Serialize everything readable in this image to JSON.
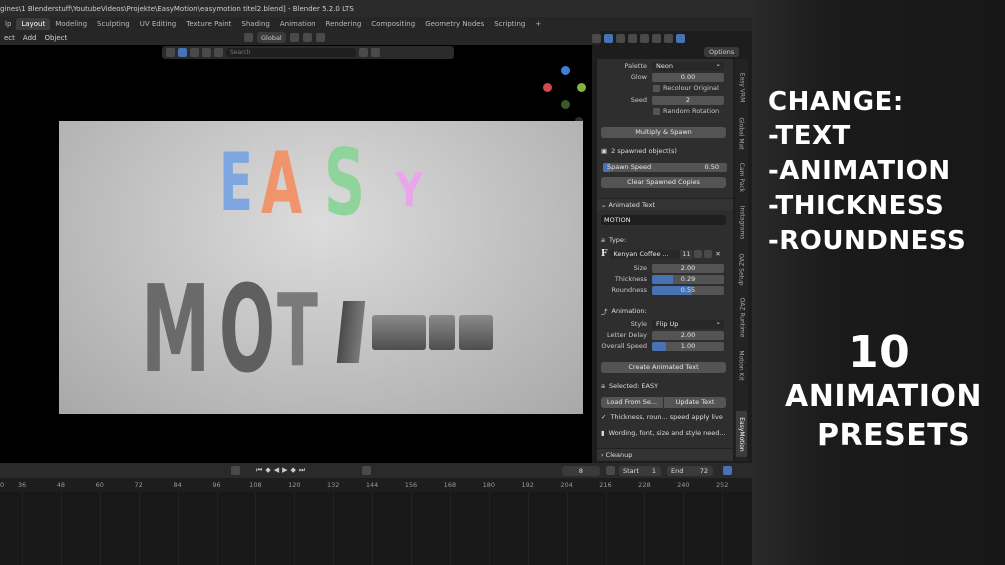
{
  "titlebar": {
    "title": "gines\\1 Blenderstuff\\YoutubeVideos\\Projekte\\EasyMotion\\easymotion titel2.blend] - Blender 5.2.0 LTS"
  },
  "workspace_tabs": [
    "lp",
    "Layout",
    "Modeling",
    "Sculpting",
    "UV Editing",
    "Texture Paint",
    "Shading",
    "Animation",
    "Rendering",
    "Compositing",
    "Geometry Nodes",
    "Scripting",
    "+"
  ],
  "menubar": [
    "ect",
    "Add",
    "Object"
  ],
  "header": {
    "transform_orientation": "Global",
    "options": "Options"
  },
  "viewport": {
    "search_placeholder": "Search"
  },
  "render_letters": [
    {
      "ch": "E",
      "color": "#7ea6e0"
    },
    {
      "ch": "A",
      "color": "#f0946c"
    },
    {
      "ch": "S",
      "color": "#8fd49a"
    },
    {
      "ch": "Y",
      "color": "#e9a6ea"
    },
    {
      "ch": "M",
      "color": "#6f6f6f"
    },
    {
      "ch": "O",
      "color": "#6f6f6f"
    },
    {
      "ch": "T",
      "color": "#6f6f6f"
    }
  ],
  "npanel": {
    "palette_label": "Palette",
    "palette_value": "Neon",
    "glow_label": "Glow",
    "glow_value": "0.00",
    "recolour_label": "Recolour Original",
    "seed_label": "Seed",
    "seed_value": "2",
    "random_rotation_label": "Random Rotation",
    "multiply_button": "Multiply & Spawn",
    "spawned_info": "2 spawned object(s)",
    "spawn_speed_label": "Spawn Speed",
    "spawn_speed_value": "0.50",
    "clear_button": "Clear Spawned Copies",
    "animated_text_header": "Animated Text",
    "text_value": "MOTION",
    "type_label": "Type:",
    "font_name": "Kenyan Coffee ...",
    "font_users": "11",
    "size_label": "Size",
    "size_value": "2.00",
    "thickness_label": "Thickness",
    "thickness_value": "0.29",
    "roundness_label": "Roundness",
    "roundness_value": "0.55",
    "animation_label": "Animation:",
    "style_label": "Style",
    "style_value": "Flip Up",
    "letter_delay_label": "Letter Delay",
    "letter_delay_value": "2.00",
    "overall_speed_label": "Overall Speed",
    "overall_speed_value": "1.00",
    "create_button": "Create Animated Text",
    "selected_info": "Selected: EASY",
    "load_button": "Load From Se...",
    "update_button": "Update Text",
    "live_info": "Thickness, roun... speed apply live",
    "wording_info": "Wording, font, size and style need...",
    "cleanup_header": "Cleanup"
  },
  "sidebar_tabs": [
    "Easy VRM",
    "Global Mat",
    "Cam Pack",
    "Instagrams",
    "OAZ Setup",
    "OAZ Runtime",
    "Motion Kit",
    "EasyMotion"
  ],
  "timeline": {
    "current_frame": "8",
    "start_label": "Start",
    "start_value": "1",
    "end_label": "End",
    "end_value": "72",
    "ticks": [
      "36",
      "48",
      "60",
      "72",
      "84",
      "96",
      "108",
      "120",
      "132",
      "144",
      "156",
      "168",
      "180",
      "192",
      "204",
      "216",
      "228",
      "240",
      "252"
    ]
  },
  "overlay": {
    "heading": "CHANGE:",
    "items": [
      "-TEXT",
      "-ANIMATION",
      "-THICKNESS",
      "-ROUNDNESS"
    ],
    "count": "10",
    "line1": "ANIMATION",
    "line2": "PRESETS"
  }
}
